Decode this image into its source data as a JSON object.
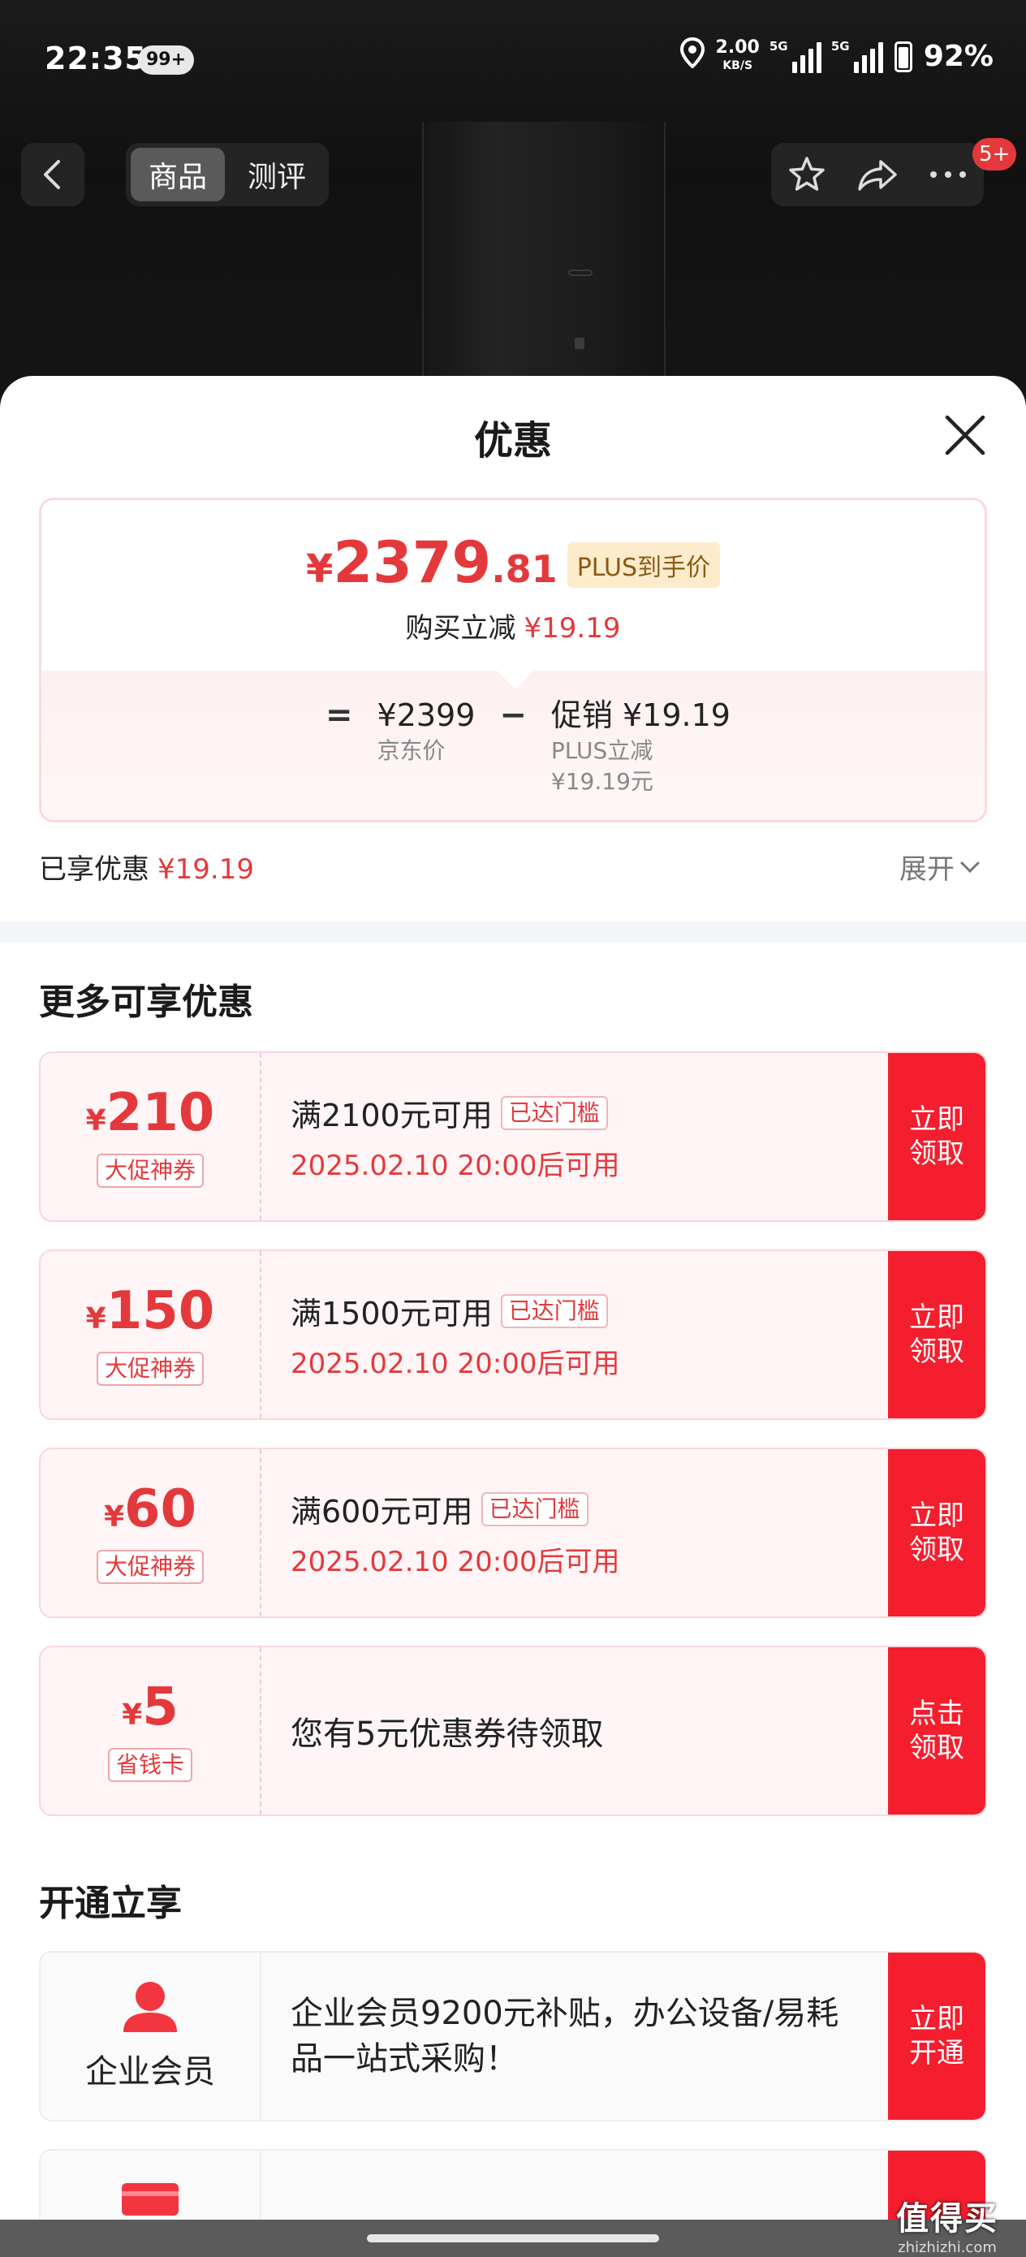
{
  "status_bar": {
    "time": "22:35",
    "notification_count": "99+",
    "net_speed": "2.00",
    "net_unit": "KB/S",
    "sim1": "5G",
    "sim2": "5G",
    "battery": "92%"
  },
  "nav": {
    "tabs": [
      {
        "label": "商品",
        "active": true
      },
      {
        "label": "测评",
        "active": false
      }
    ],
    "message_badge": "5+"
  },
  "sheet": {
    "title": "优惠",
    "price_card": {
      "currency": "¥",
      "price_int": "2379",
      "price_dec": ".81",
      "plus_tag": "PLUS到手价",
      "save_label": "购买立减",
      "save_amount": "¥19.19",
      "op_equals": "=",
      "jd_price": "¥2399",
      "jd_price_label": "京东价",
      "op_minus": "−",
      "promo": "促销 ¥19.19",
      "promo_detail_1": "PLUS立减",
      "promo_detail_2": "¥19.19元"
    },
    "enjoyed_label": "已享优惠",
    "enjoyed_amount": "¥19.19",
    "expand_label": "展开"
  },
  "more_offers": {
    "title": "更多可享优惠",
    "coupons": [
      {
        "currency": "¥",
        "value": "210",
        "kind": "大促神券",
        "condition": "满2100元可用",
        "reach": "已达门槛",
        "time": "2025.02.10 20:00后可用",
        "action": "立即领取"
      },
      {
        "currency": "¥",
        "value": "150",
        "kind": "大促神券",
        "condition": "满1500元可用",
        "reach": "已达门槛",
        "time": "2025.02.10 20:00后可用",
        "action": "立即领取"
      },
      {
        "currency": "¥",
        "value": "60",
        "kind": "大促神券",
        "condition": "满600元可用",
        "reach": "已达门槛",
        "time": "2025.02.10 20:00后可用",
        "action": "立即领取"
      },
      {
        "currency": "¥",
        "value": "5",
        "kind": "省钱卡",
        "text": "您有5元优惠券待领取",
        "action": "点击领取"
      }
    ]
  },
  "open_enjoy": {
    "title": "开通立享",
    "member": {
      "icon": "person-icon",
      "label": "企业会员",
      "desc": "企业会员9200元补贴，办公设备/易耗品一站式采购！",
      "action": "立即开通"
    },
    "second_card_icon": "card-icon"
  },
  "watermark": {
    "main": "值得买",
    "sub": "zhizhizhi.com"
  },
  "colors": {
    "accent": "#f41e2e",
    "price_red": "#e4393c",
    "plus_gold": "#fdeccb"
  }
}
